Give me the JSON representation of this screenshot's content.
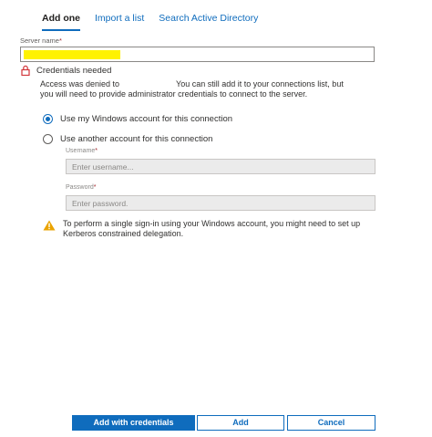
{
  "tabs": [
    {
      "label": "Add one"
    },
    {
      "label": "Import a list"
    },
    {
      "label": "Search Active Directory"
    }
  ],
  "server": {
    "label": "Server name",
    "required_marker": "*",
    "value": ""
  },
  "credentials": {
    "status": "Credentials needed",
    "description_part1": "Access was denied to",
    "description_part2": "You can still add it to your connections list, but you will need to provide administrator credentials to connect to the server."
  },
  "options": {
    "windows_account": "Use my Windows account for this connection",
    "another_account": "Use another account for this connection",
    "selected": "windows_account"
  },
  "username": {
    "label": "Username",
    "required_marker": "*",
    "placeholder": "Enter username..."
  },
  "password": {
    "label": "Password",
    "required_marker": "*",
    "placeholder": "Enter password."
  },
  "warning": {
    "text": "To perform a single sign-in using your Windows account, you might need to set up Kerberos constrained delegation."
  },
  "buttons": {
    "add_with_credentials": "Add with credentials",
    "add": "Add",
    "cancel": "Cancel"
  },
  "colors": {
    "accent": "#0f6cbd",
    "warning": "#eaa300",
    "lock": "#d13438",
    "redaction": "#fff200"
  },
  "icons": {
    "lock": "lock-icon",
    "warning": "warning-icon"
  }
}
